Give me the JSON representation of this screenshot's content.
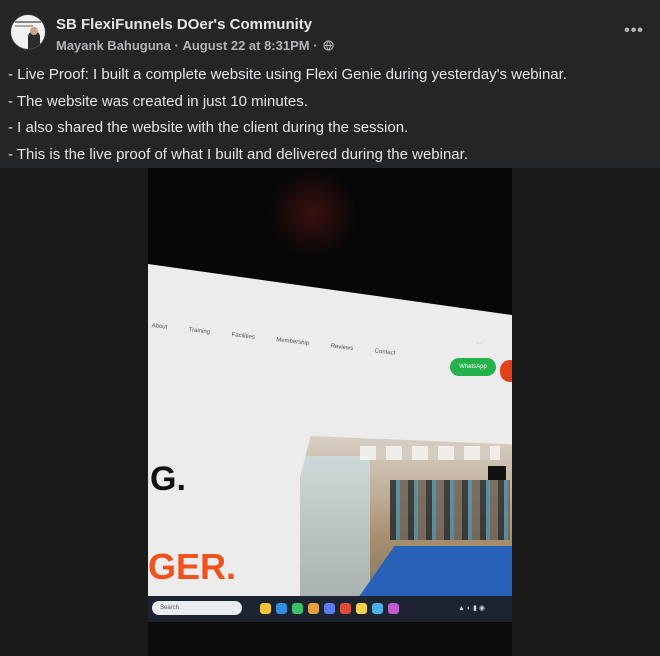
{
  "post": {
    "group_name": "SB FlexiFunnels DOer's Community",
    "author": "Mayank Bahuguna",
    "separator": "·",
    "timestamp": "August 22 at 8:31PM",
    "separator2": "·",
    "audience_icon": "globe-icon",
    "more_label": "•••",
    "lines": [
      "- Live Proof: I built a complete website using Flexi Genie during yesterday's webinar.",
      "- The website was created in just 10 minutes.",
      "- I also shared the website with the client during the session.",
      "- This is the live proof of what I built and delivered during the webinar."
    ]
  },
  "video": {
    "nav_items": [
      "About",
      "Training",
      "Facilities",
      "Membership",
      "Reviews",
      "Contact"
    ],
    "whatsapp_label": "WhatsApp",
    "hero_line1": "G.",
    "hero_line2": "GER.",
    "search_placeholder": "Search"
  },
  "colors": {
    "background": "#242526",
    "text_primary": "#e4e6eb",
    "text_secondary": "#b0b3b8",
    "hero_accent": "#f0521c",
    "whatsapp_green": "#25b24a"
  }
}
